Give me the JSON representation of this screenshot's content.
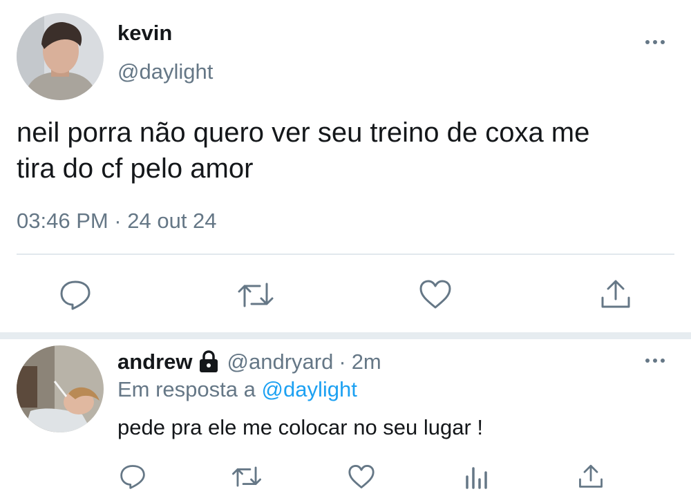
{
  "main_tweet": {
    "display_name": "kevin",
    "handle": "@daylight",
    "text_line1": "neil porra não quero ver seu treino de coxa me",
    "text_line2": "tira do cf pelo amor",
    "timestamp": "03:46 PM · 24 out 24",
    "actions": [
      "reply-icon",
      "retweet-icon",
      "like-icon",
      "share-icon"
    ]
  },
  "reply_tweet": {
    "display_name": "andrew",
    "locked_icon": "lock-icon",
    "handle": "@andryard",
    "separator": "·",
    "time_ago": "2m",
    "in_reply_prefix": "Em resposta a",
    "in_reply_handle": "@daylight",
    "text": "pede pra ele me colocar no seu lugar !",
    "actions": [
      "reply-icon",
      "retweet-icon",
      "like-icon",
      "analytics-icon",
      "share-icon"
    ]
  },
  "colors": {
    "text": "#14171a",
    "muted": "#657786",
    "link": "#1da1f2",
    "divider": "#e1e8ed"
  }
}
